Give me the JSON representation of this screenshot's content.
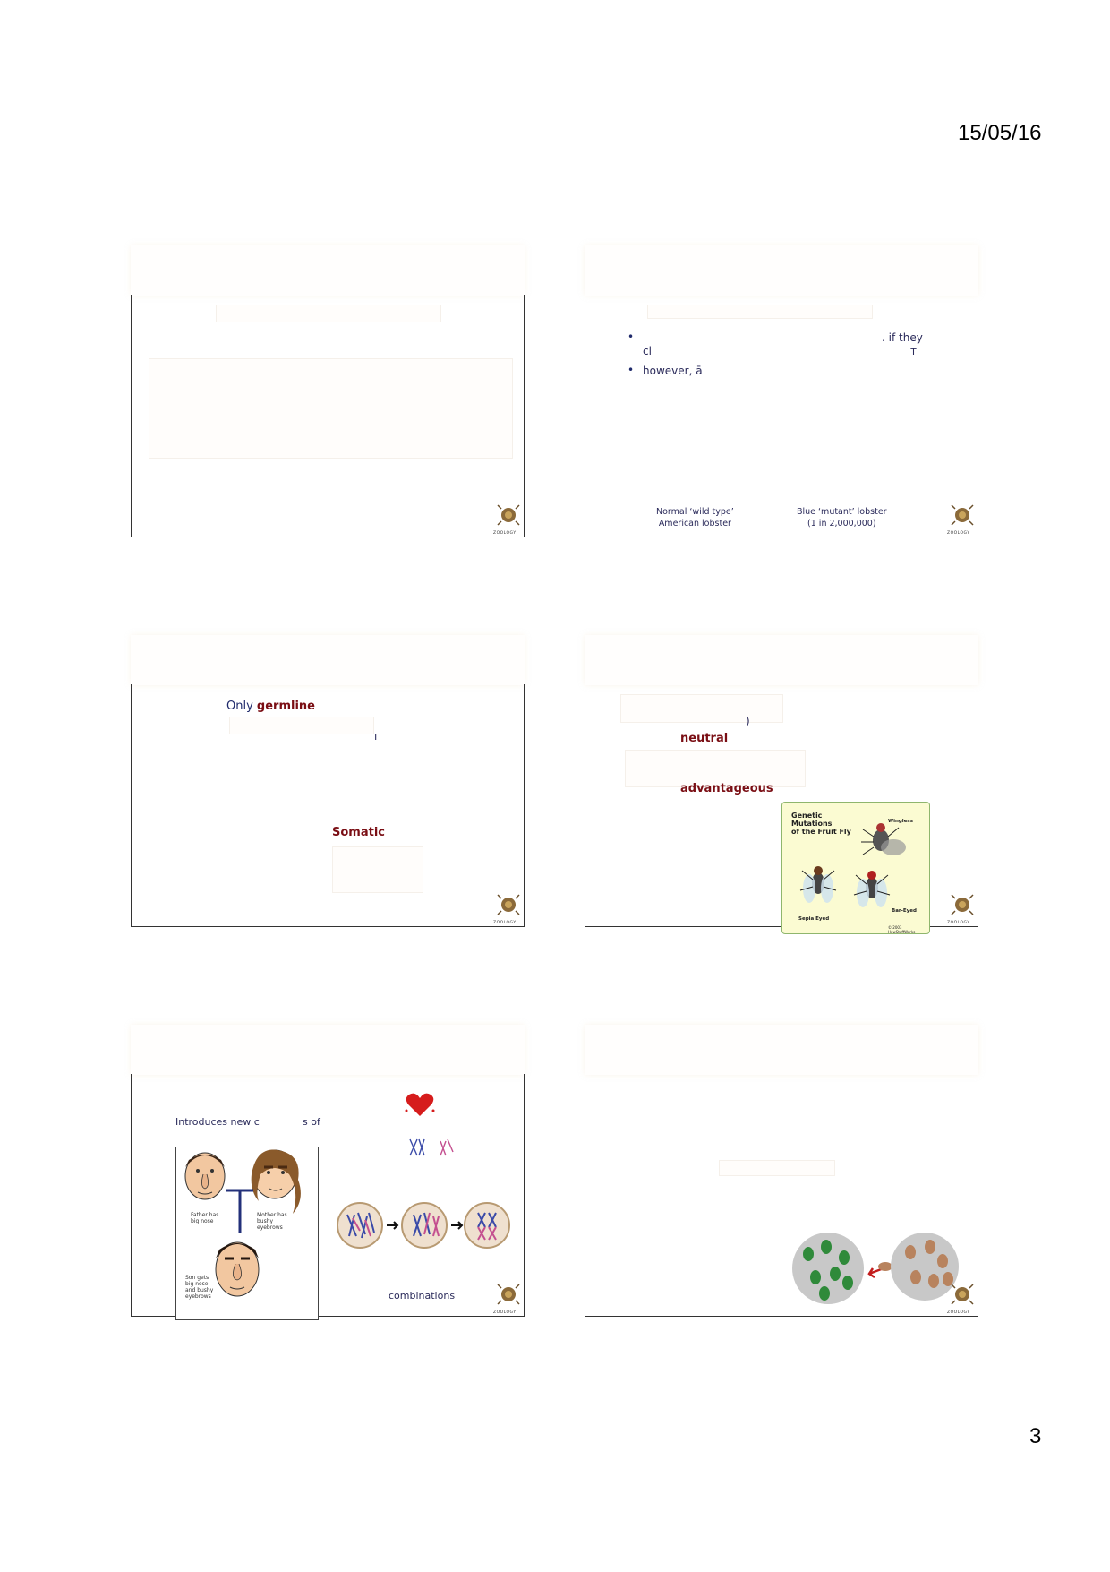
{
  "page": {
    "date": "15/05/16",
    "number": "3"
  },
  "slides": {
    "s2": {
      "line1_end": ". if they",
      "line2_start": "cl",
      "line2_end": "т",
      "line3": "however, ā",
      "caption_left": "Normal ‘wild type’\nAmerican lobster",
      "caption_left_1": "Normal ‘wild type’",
      "caption_left_2": "American lobster",
      "caption_right_1": "Blue ‘mutant’ lobster",
      "caption_right_2": "(1 in 2,000,000)"
    },
    "s3": {
      "only": "Only ",
      "germline": "germline",
      "tick": "ı",
      "somatic": "Somatic"
    },
    "s4": {
      "paren": ")",
      "neutral": "neutral",
      "advantageous": "advantageous",
      "figure_title_1": "Genetic",
      "figure_title_2": "Mutations",
      "figure_title_3": "of the Fruit Fly",
      "label_wingless": "Wingless",
      "label_sepia": "Sepia Eyed",
      "label_bar": "Bar-Eyed",
      "label_credit": "© 2003 HowStuffWorks"
    },
    "s5": {
      "intro_start": "Introduces new c",
      "intro_end": "s of",
      "father": "Father has\nbig nose",
      "father_1": "Father has",
      "father_2": "big nose",
      "mother_1": "Mother has",
      "mother_2": "bushy",
      "mother_3": "eyebrows",
      "son_1": "Son gets",
      "son_2": "big nose",
      "son_3": "and bushy",
      "son_4": "eyebrows",
      "combinations": "combinations"
    },
    "logo_label": "ZOOLOGY"
  },
  "colors": {
    "maroon": "#7a0e14",
    "navy": "#1f2a6b",
    "frame": "#333333"
  }
}
